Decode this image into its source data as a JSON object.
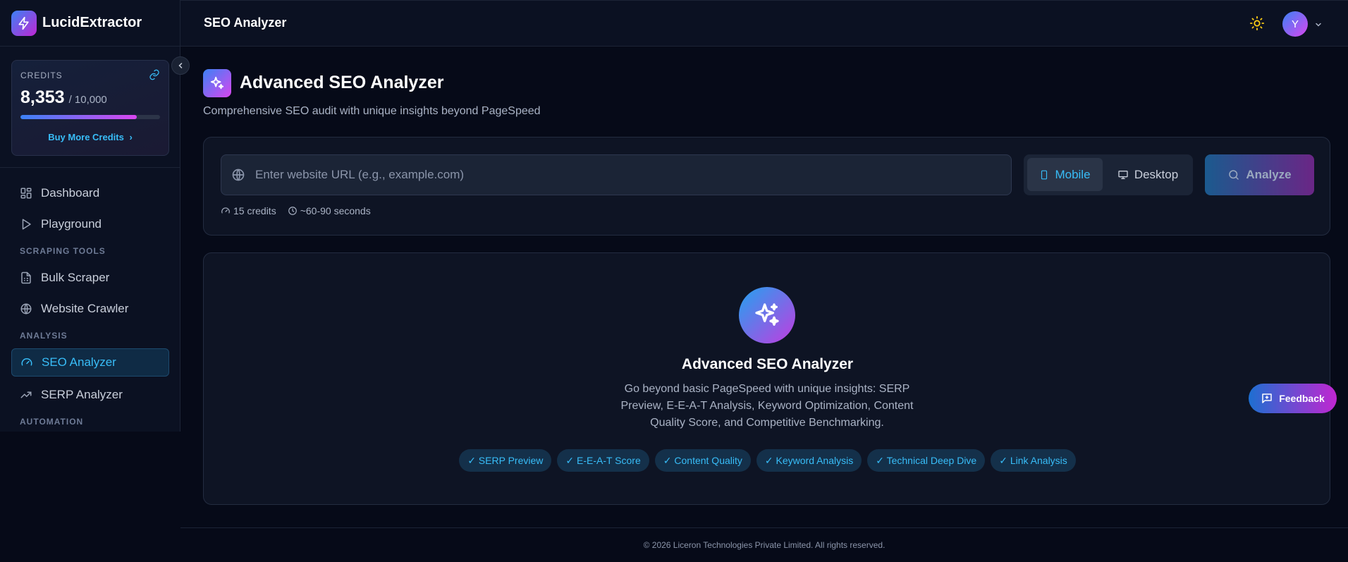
{
  "brand": {
    "name": "LucidExtractor"
  },
  "credits": {
    "label": "CREDITS",
    "used": "8,353",
    "total": "/ 10,000",
    "fraction": 0.8353,
    "buy_label": "Buy More Credits"
  },
  "sidebar": {
    "items": [
      {
        "label": "Dashboard"
      },
      {
        "label": "Playground"
      },
      {
        "label": "Bulk Scraper"
      },
      {
        "label": "Website Crawler"
      },
      {
        "label": "SEO Analyzer"
      },
      {
        "label": "SERP Analyzer"
      }
    ],
    "sections": {
      "scraping": "SCRAPING TOOLS",
      "analysis": "ANALYSIS",
      "automation": "AUTOMATION"
    }
  },
  "topbar": {
    "title": "SEO Analyzer",
    "avatar_initial": "Y"
  },
  "page": {
    "title": "Advanced SEO Analyzer",
    "subtitle": "Comprehensive SEO audit with unique insights beyond PageSpeed"
  },
  "form": {
    "url_placeholder": "Enter website URL (e.g., example.com)",
    "url_value": "",
    "device_mobile": "Mobile",
    "device_desktop": "Desktop",
    "selected_device": "Mobile",
    "analyze_label": "Analyze",
    "credits_cost": "15 credits",
    "duration": "~60-90 seconds"
  },
  "empty_state": {
    "title": "Advanced SEO Analyzer",
    "description": "Go beyond basic PageSpeed with unique insights: SERP Preview, E-E-A-T Analysis, Keyword Optimization, Content Quality Score, and Competitive Benchmarking.",
    "features": [
      "✓ SERP Preview",
      "✓ E-E-A-T Score",
      "✓ Content Quality",
      "✓ Keyword Analysis",
      "✓ Technical Deep Dive",
      "✓ Link Analysis"
    ]
  },
  "feedback": {
    "label": "Feedback"
  },
  "footer": {
    "text": "© 2026 Liceron Technologies Private Limited. All rights reserved."
  },
  "colors": {
    "accent": "#38bdf8",
    "gradient_start": "#3b82f6",
    "gradient_end": "#d946ef"
  }
}
